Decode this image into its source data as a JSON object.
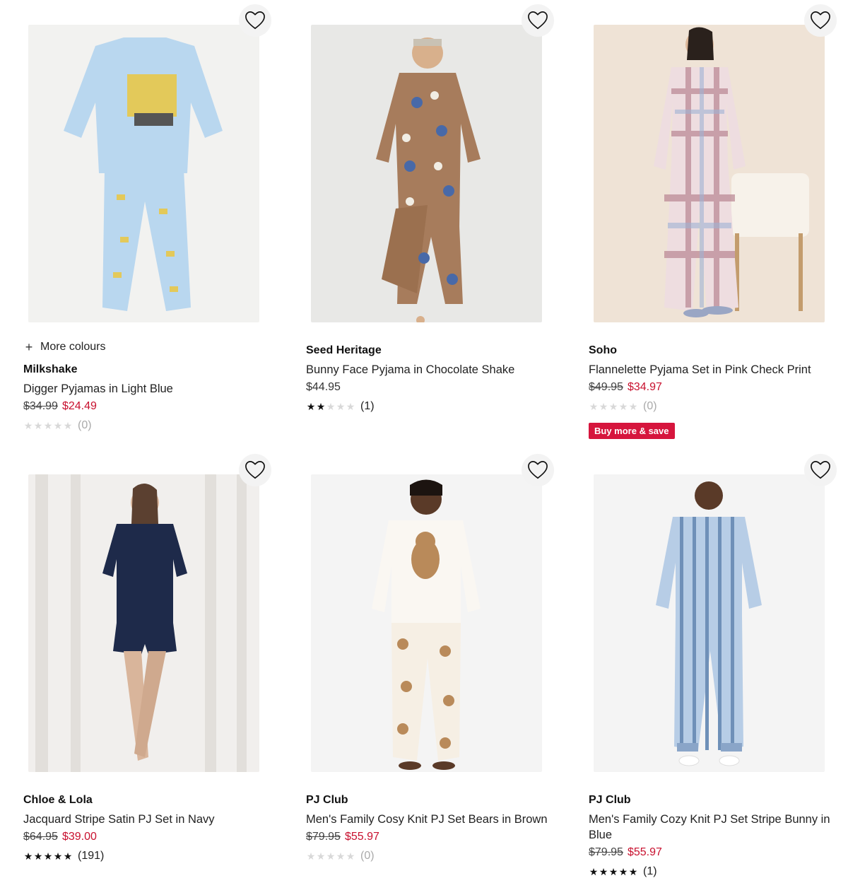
{
  "colors": {
    "sale": "#c8102e",
    "badge": "#d6153d",
    "star_on": "#111111",
    "star_off": "#d8d8d8"
  },
  "products": [
    {
      "more_colours": "More colours",
      "brand": "Milkshake",
      "title": "Digger Pyjamas in Light Blue",
      "was": "$34.99",
      "now": "$24.49",
      "rating_stars": 0,
      "rating_count": "(0)",
      "icon": "heart-icon"
    },
    {
      "brand": "Seed Heritage",
      "title": "Bunny Face Pyjama in Chocolate Shake",
      "regular": "$44.95",
      "rating_stars": 2,
      "rating_count": "(1)",
      "icon": "heart-icon"
    },
    {
      "brand": "Soho",
      "title": "Flannelette Pyjama Set in Pink Check Print",
      "was": "$49.95",
      "now": "$34.97",
      "rating_stars": 0,
      "rating_count": "(0)",
      "badge": "Buy more & save",
      "icon": "heart-icon"
    },
    {
      "brand": "Chloe & Lola",
      "title": "Jacquard Stripe Satin PJ Set in Navy",
      "was": "$64.95",
      "now": "$39.00",
      "rating_stars": 5,
      "rating_count": "(191)",
      "icon": "heart-icon"
    },
    {
      "brand": "PJ Club",
      "title": "Men's Family Cosy Knit PJ Set Bears in Brown",
      "was": "$79.95",
      "now": "$55.97",
      "rating_stars": 0,
      "rating_count": "(0)",
      "icon": "heart-icon"
    },
    {
      "brand": "PJ Club",
      "title": "Men's Family Cozy Knit PJ Set Stripe Bunny in Blue",
      "was": "$79.95",
      "now": "$55.97",
      "rating_stars": 5,
      "rating_count": "(1)",
      "icon": "heart-icon"
    }
  ]
}
